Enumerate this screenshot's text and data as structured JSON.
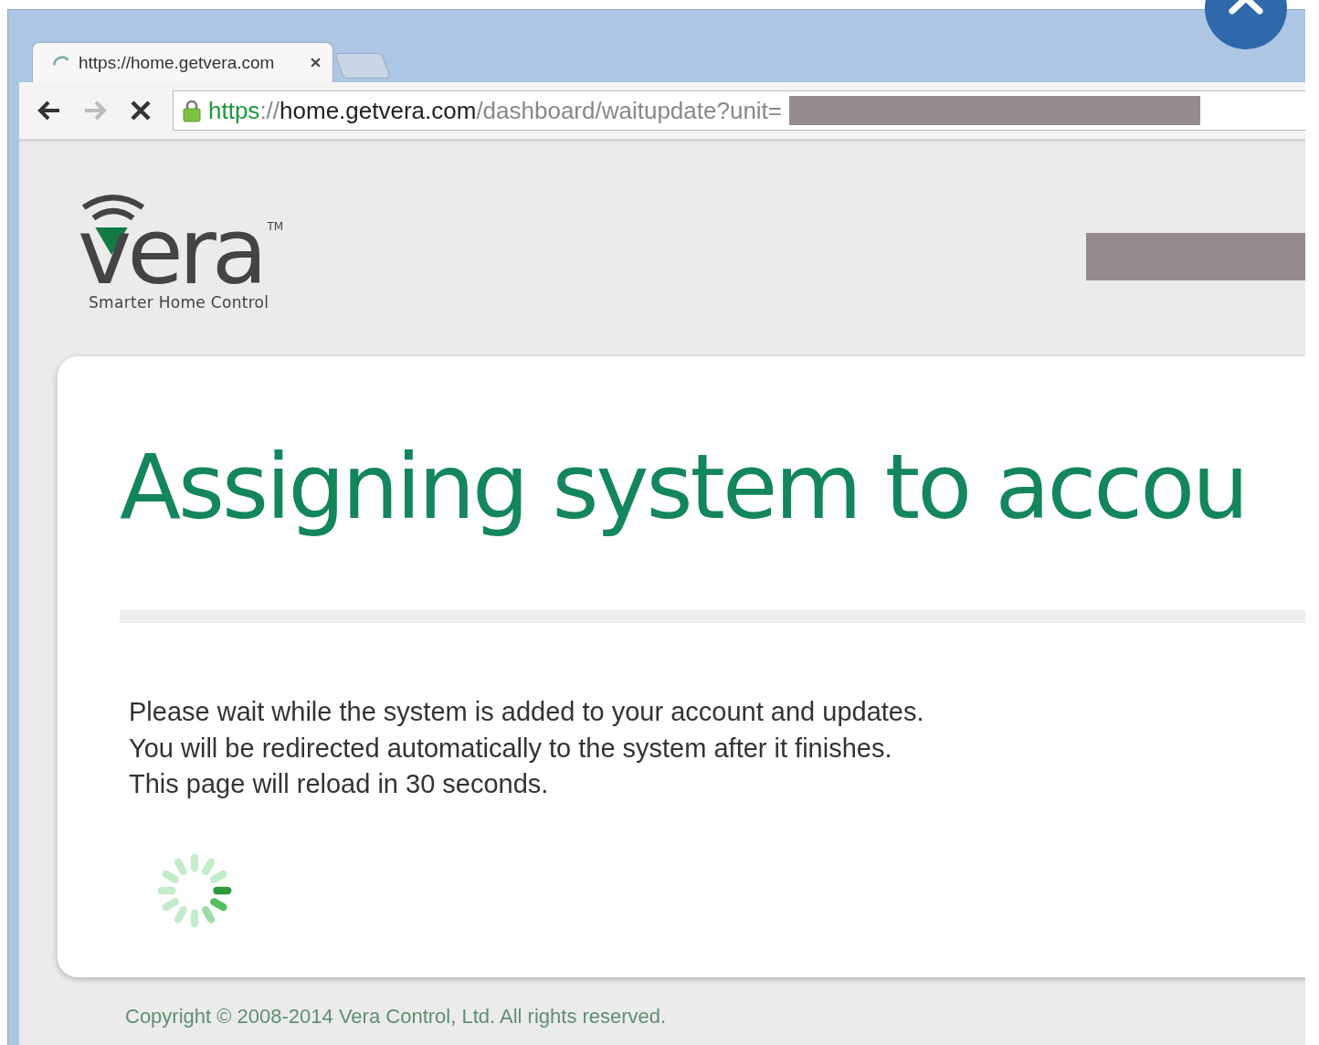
{
  "browser": {
    "tab": {
      "title": "https://home.getvera.com",
      "loading": true
    },
    "nav": {
      "back_disabled": false,
      "forward_disabled": true
    },
    "address_bar": {
      "scheme": "https",
      "separator": "://",
      "host": "home.getvera.com",
      "path": "/dashboard/waitupdate?unit="
    }
  },
  "page": {
    "logo": {
      "wordmark": "vera",
      "trademark": "TM",
      "tagline": "Smarter Home Control"
    },
    "card": {
      "heading": "Assigning system to accou",
      "lines": [
        "Please wait while the system is added to your account and updates.",
        "You will be redirected automatically to the system after it finishes.",
        "This page will reload in 30 seconds."
      ]
    },
    "footer": "Copyright © 2008-2014 Vera Control, Ltd. All rights reserved."
  }
}
